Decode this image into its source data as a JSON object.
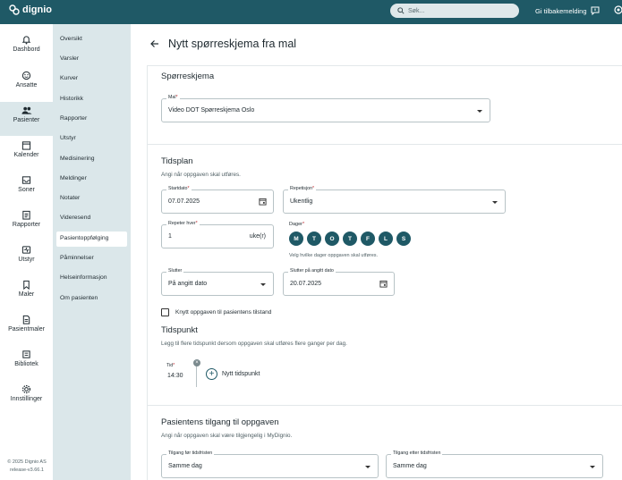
{
  "app": {
    "logo_text": "dignio",
    "search_placeholder": "Søk...",
    "feedback_label": "Gi tilbakemelding"
  },
  "nav": {
    "items": [
      {
        "label": "Dashbord",
        "icon": "bell-icon"
      },
      {
        "label": "Ansatte",
        "icon": "smile-icon"
      },
      {
        "label": "Pasienter",
        "icon": "people-icon",
        "active": true
      },
      {
        "label": "Kalender",
        "icon": "calendar-icon"
      },
      {
        "label": "Soner",
        "icon": "inbox-icon"
      },
      {
        "label": "Rapporter",
        "icon": "clipboard-icon"
      },
      {
        "label": "Utstyr",
        "icon": "device-icon"
      },
      {
        "label": "Maler",
        "icon": "bookmark-icon"
      },
      {
        "label": "Pasientmaler",
        "icon": "file-icon"
      },
      {
        "label": "Bibliotek",
        "icon": "library-icon"
      },
      {
        "label": "Innstillinger",
        "icon": "gear-icon"
      }
    ],
    "footer_copyright": "© 2025 Dignio AS",
    "footer_release": "release-v3.66.1"
  },
  "subnav": {
    "items": [
      "Oversikt",
      "Varsler",
      "Kurver",
      "Historikk",
      "Rapporter",
      "Utstyr",
      "Medisinering",
      "Meldinger",
      "Notater",
      "Videresend",
      "Pasientoppfølging",
      "Påminnelser",
      "Helseinformasjon",
      "Om pasienten"
    ],
    "active_index": 10
  },
  "page": {
    "title": "Nytt spørreskjema fra mal"
  },
  "questionnaire": {
    "heading": "Spørreskjema",
    "template_label": "Mal",
    "template_value": "Video DOT Spørreskjema Oslo"
  },
  "schedule": {
    "heading": "Tidsplan",
    "hint": "Angi når oppgaven skal utføres.",
    "start_label": "Startdato",
    "start_value": "07.07.2025",
    "repeat_label": "Repetisjon",
    "repeat_value": "Ukentlig",
    "repeat_every_label": "Repeter hver",
    "repeat_every_value": "1",
    "repeat_every_unit": "uke(r)",
    "days_label": "Dager",
    "days": [
      "M",
      "T",
      "O",
      "T",
      "F",
      "L",
      "S"
    ],
    "days_hint": "Velg hvilke dager oppgaven skal utføres.",
    "ends_label": "Slutter",
    "ends_value": "På angitt dato",
    "ends_on_label": "Slutter på angitt dato",
    "ends_on_value": "20.07.2025",
    "link_label": "Knytt oppgaven til pasientens tilstand"
  },
  "timepoint": {
    "heading": "Tidspunkt",
    "hint": "Legg til flere tidspunkt dersom oppgaven skal utføres flere ganger per dag.",
    "time_label": "Tid",
    "time_value": "14:30",
    "add_label": "Nytt tidspunkt"
  },
  "access": {
    "heading": "Pasientens tilgang til oppgaven",
    "hint": "Angi når oppgaven skal være tilgjengelig i MyDignio.",
    "before_label": "Tilgang før tidsfristen",
    "before_value": "Samme dag",
    "after_label": "Tilgang etter tidsfristen",
    "after_value": "Samme dag"
  },
  "colors": {
    "topbar": "#1f5966",
    "subnav_bg": "#dbe7ea",
    "required": "#c1272d"
  }
}
